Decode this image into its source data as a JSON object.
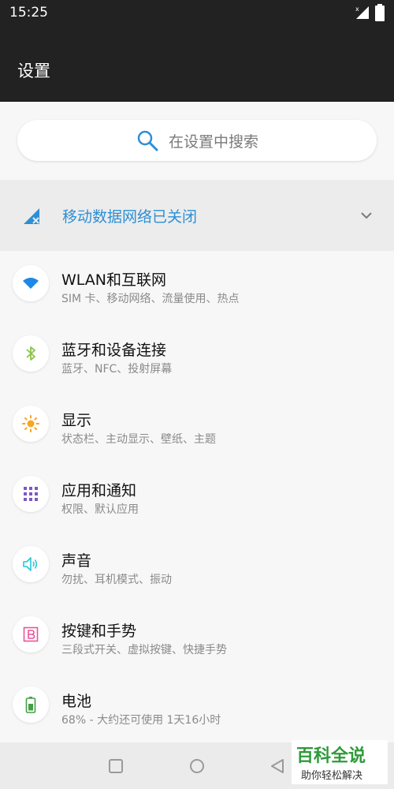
{
  "status_bar": {
    "time": "15:25"
  },
  "app_bar": {
    "title": "设置"
  },
  "search": {
    "placeholder": "在设置中搜索"
  },
  "notice": {
    "text": "移动数据网络已关闭"
  },
  "settings": [
    {
      "title": "WLAN和互联网",
      "subtitle": "SIM 卡、移动网络、流量使用、热点",
      "icon": "wifi-icon",
      "color": "#1e88e5"
    },
    {
      "title": "蓝牙和设备连接",
      "subtitle": "蓝牙、NFC、投射屏幕",
      "icon": "bluetooth-icon",
      "color": "#8bc34a"
    },
    {
      "title": "显示",
      "subtitle": "状态栏、主动显示、壁纸、主题",
      "icon": "brightness-icon",
      "color": "#f5a623"
    },
    {
      "title": "应用和通知",
      "subtitle": "权限、默认应用",
      "icon": "apps-grid-icon",
      "color": "#7e57c2"
    },
    {
      "title": "声音",
      "subtitle": "勿扰、耳机模式、振动",
      "icon": "speaker-icon",
      "color": "#26c6da"
    },
    {
      "title": "按键和手势",
      "subtitle": "三段式开关、虚拟按键、快捷手势",
      "icon": "button-b-icon",
      "color": "#e9559a"
    },
    {
      "title": "电池",
      "subtitle": "68% - 大约还可使用 1天16小时",
      "icon": "battery-icon",
      "color": "#43a047"
    }
  ],
  "watermark": {
    "title": "百科全说",
    "subtitle": "助你轻松解决"
  },
  "colors": {
    "accent": "#2d8fd5",
    "header": "#222222",
    "background": "#f7f7f7"
  }
}
